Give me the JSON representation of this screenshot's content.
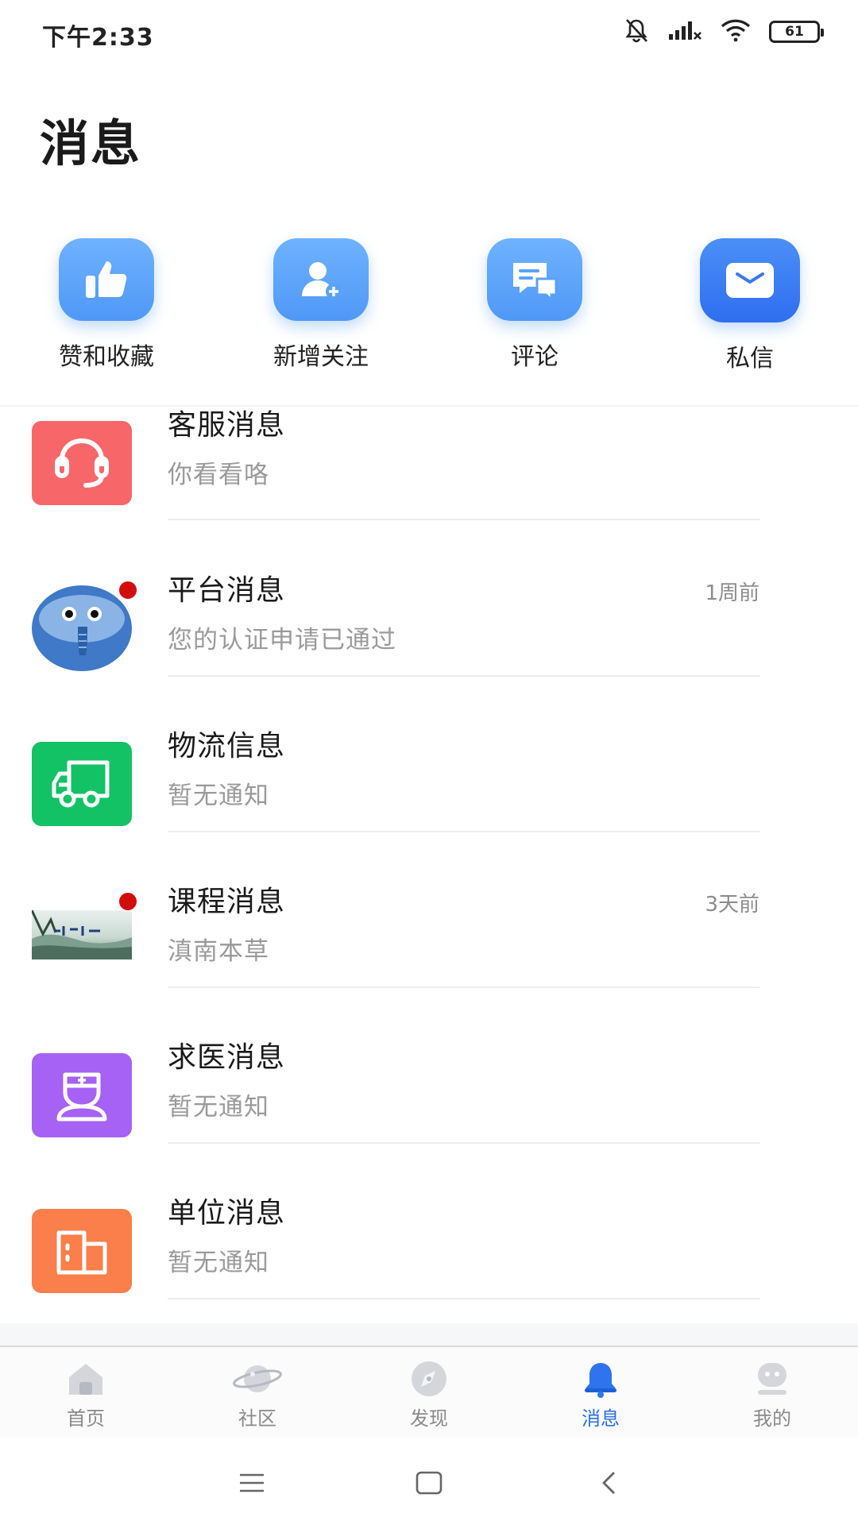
{
  "status_bar": {
    "time": "下午2:33",
    "battery": "61",
    "icons": [
      "bell-muted-icon",
      "signal-icon",
      "wifi-icon",
      "battery-icon"
    ]
  },
  "page": {
    "title": "消息"
  },
  "quick_actions": [
    {
      "label": "赞和收藏",
      "icon": "thumbs-up-icon"
    },
    {
      "label": "新增关注",
      "icon": "add-user-icon"
    },
    {
      "label": "评论",
      "icon": "comment-icon"
    },
    {
      "label": "私信",
      "icon": "mail-icon"
    }
  ],
  "messages": [
    {
      "title": "客服消息",
      "subtitle": "你看看咯",
      "time": "",
      "unread": false,
      "icon": "headset-icon",
      "color": "#f7676a"
    },
    {
      "title": "平台消息",
      "subtitle": "您的认证申请已通过",
      "time": "1周前",
      "unread": true,
      "icon": "elephant-avatar",
      "color": "#3f79c8"
    },
    {
      "title": "物流信息",
      "subtitle": "暂无通知",
      "time": "",
      "unread": false,
      "icon": "truck-icon",
      "color": "#12c264"
    },
    {
      "title": "课程消息",
      "subtitle": "滇南本草",
      "time": "3天前",
      "unread": true,
      "icon": "landscape-thumbnail",
      "color": "#8fb0a4"
    },
    {
      "title": "求医消息",
      "subtitle": "暂无通知",
      "time": "",
      "unread": false,
      "icon": "nurse-icon",
      "color": "#a661f5"
    },
    {
      "title": "单位消息",
      "subtitle": "暂无通知",
      "time": "",
      "unread": false,
      "icon": "building-icon",
      "color": "#fa7f4b"
    }
  ],
  "tab_bar": {
    "items": [
      {
        "label": "首页",
        "icon": "home-icon",
        "active": false
      },
      {
        "label": "社区",
        "icon": "planet-icon",
        "active": false
      },
      {
        "label": "发现",
        "icon": "compass-icon",
        "active": false
      },
      {
        "label": "消息",
        "icon": "bell-icon",
        "active": true
      },
      {
        "label": "我的",
        "icon": "profile-icon",
        "active": false
      }
    ],
    "active_color": "#2b6fe3",
    "inactive_color": "#8a8a8a"
  },
  "system_nav": [
    "menu-icon",
    "home-square-icon",
    "back-icon"
  ]
}
